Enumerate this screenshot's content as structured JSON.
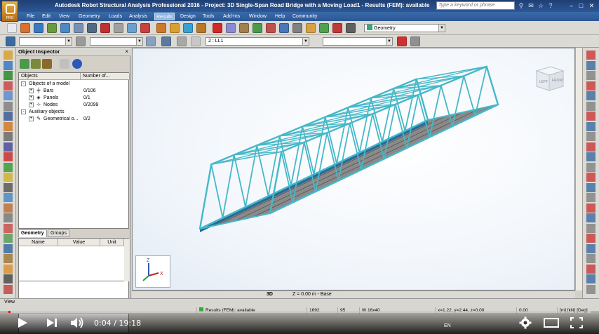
{
  "window": {
    "title": "Autodesk Robot Structural Analysis Professional 2016 - Project: 3D Single-Span Road Bridge with a Moving Load1 - Results (FEM): available",
    "search_placeholder": "Type a keyword or phrase",
    "logo_text": "PRO"
  },
  "menu": [
    "File",
    "Edit",
    "View",
    "Geometry",
    "Loads",
    "Analysis",
    "Results",
    "Design",
    "Tools",
    "Add-Ins",
    "Window",
    "Help",
    "Community"
  ],
  "menu_active": "Results",
  "toolbar": {
    "layout_combo": "Geometry",
    "case_combo": "2 : LL1"
  },
  "inspector": {
    "title": "Object Inspector",
    "columns": [
      "Objects",
      "Number of..."
    ],
    "tree": [
      {
        "label": "Objects of a model",
        "count": "",
        "level": 0,
        "toggle": "-"
      },
      {
        "label": "Bars",
        "count": "0/106",
        "level": 1,
        "toggle": "+"
      },
      {
        "label": "Panels",
        "count": "0/1",
        "level": 1,
        "toggle": "+"
      },
      {
        "label": "Nodes",
        "count": "0/2099",
        "level": 1,
        "toggle": "+"
      },
      {
        "label": "Auxiliary objects",
        "count": "",
        "level": 0,
        "toggle": "-"
      },
      {
        "label": "Geometrical o...",
        "count": "0/2",
        "level": 1,
        "toggle": "+"
      }
    ],
    "tabs": [
      "Geometry",
      "Groups"
    ],
    "prop_columns": [
      "Name",
      "Value",
      "Unit"
    ]
  },
  "viewport": {
    "view_mode": "3D",
    "plane": "Z = 0.00 m - Base",
    "cube_left": "LEFT",
    "cube_front": "FRONT"
  },
  "status": {
    "view_label": "View",
    "results": "Results (FEM): available",
    "num1": "1692",
    "num2": "95",
    "section": "W 16x40",
    "coords": "x=1.22, y=2.44, z=0.00",
    "value": "0.00",
    "units": "[m] [kN] [Deg]"
  },
  "player": {
    "time": "0:04 / 19:18",
    "progress": 0.0035,
    "lang": "EN"
  },
  "colors": {
    "truss": "#45b8c8",
    "deck": "#8a8a8a",
    "progress": "#ff0000"
  }
}
